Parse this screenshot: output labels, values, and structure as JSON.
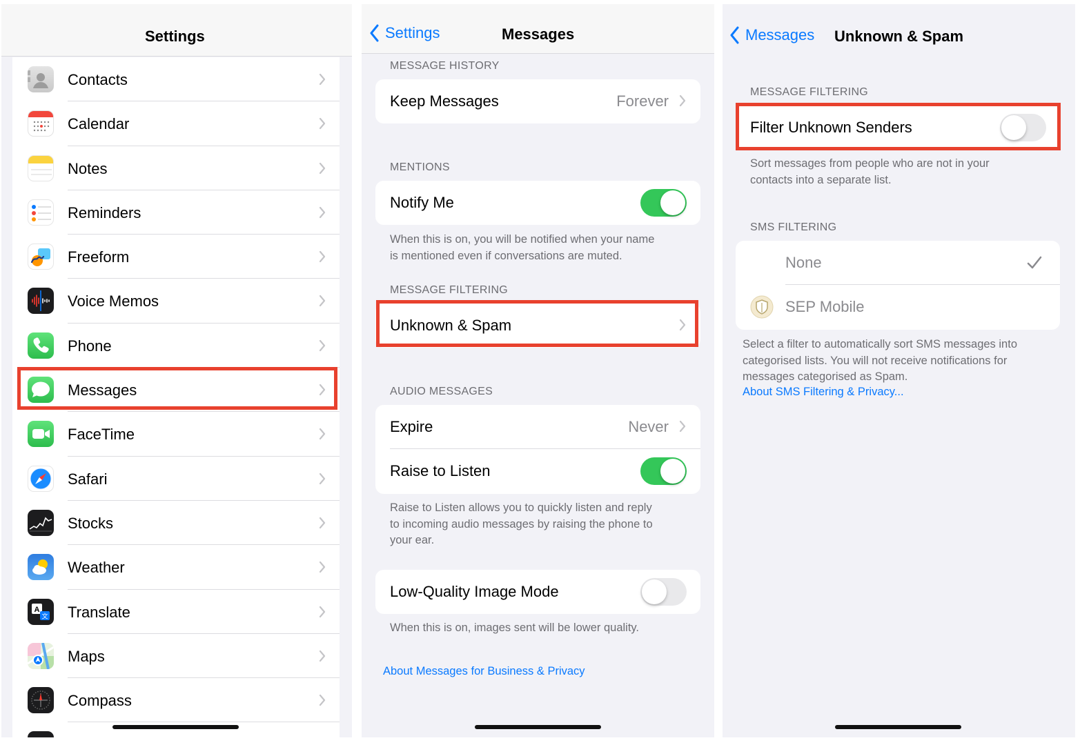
{
  "settings_panel": {
    "title": "Settings",
    "items": [
      {
        "label": "Contacts",
        "icon": "contacts-icon"
      },
      {
        "label": "Calendar",
        "icon": "calendar-icon"
      },
      {
        "label": "Notes",
        "icon": "notes-icon"
      },
      {
        "label": "Reminders",
        "icon": "reminders-icon"
      },
      {
        "label": "Freeform",
        "icon": "freeform-icon"
      },
      {
        "label": "Voice Memos",
        "icon": "voice-memos-icon"
      },
      {
        "label": "Phone",
        "icon": "phone-icon"
      },
      {
        "label": "Messages",
        "icon": "messages-icon",
        "highlighted": true
      },
      {
        "label": "FaceTime",
        "icon": "facetime-icon"
      },
      {
        "label": "Safari",
        "icon": "safari-icon"
      },
      {
        "label": "Stocks",
        "icon": "stocks-icon"
      },
      {
        "label": "Weather",
        "icon": "weather-icon"
      },
      {
        "label": "Translate",
        "icon": "translate-icon"
      },
      {
        "label": "Maps",
        "icon": "maps-icon"
      },
      {
        "label": "Compass",
        "icon": "compass-icon"
      }
    ]
  },
  "messages_panel": {
    "back_label": "Settings",
    "title": "Messages",
    "message_history": {
      "header": "MESSAGE HISTORY",
      "keep_messages_label": "Keep Messages",
      "keep_messages_value": "Forever"
    },
    "mentions": {
      "header": "MENTIONS",
      "notify_me_label": "Notify Me",
      "notify_me_on": true,
      "footer_line1": "When this is on, you will be notified when your name",
      "footer_line2": "is mentioned even if conversations are muted."
    },
    "message_filtering": {
      "header": "MESSAGE FILTERING",
      "unknown_spam_label": "Unknown & Spam"
    },
    "audio_messages": {
      "header": "AUDIO MESSAGES",
      "expire_label": "Expire",
      "expire_value": "Never",
      "raise_label": "Raise to Listen",
      "raise_on": true,
      "footer_line1": "Raise to Listen allows you to quickly listen and reply",
      "footer_line2": "to incoming audio messages by raising the phone to",
      "footer_line3": "your ear."
    },
    "low_quality": {
      "label": "Low-Quality Image Mode",
      "on": false,
      "footer": "When this is on, images sent will be lower quality."
    },
    "business_link": "About Messages for Business & Privacy"
  },
  "spam_panel": {
    "back_label": "Messages",
    "title": "Unknown & Spam",
    "message_filtering": {
      "header": "MESSAGE FILTERING",
      "filter_label": "Filter Unknown Senders",
      "filter_on": false,
      "footer_line1": "Sort messages from people who are not in your",
      "footer_line2": "contacts into a separate list."
    },
    "sms_filtering": {
      "header": "SMS FILTERING",
      "options": [
        {
          "label": "None",
          "selected": true
        },
        {
          "label": "SEP Mobile",
          "selected": false
        }
      ],
      "footer_line1": "Select a filter to automatically sort SMS messages into",
      "footer_line2": "categorised lists. You will not receive notifications for",
      "footer_line3": "messages categorised as Spam.",
      "link": "About SMS Filtering & Privacy..."
    }
  },
  "colors": {
    "accent_blue": "#0a7aff",
    "toggle_green": "#34c759",
    "highlight_red": "#e8412e"
  }
}
